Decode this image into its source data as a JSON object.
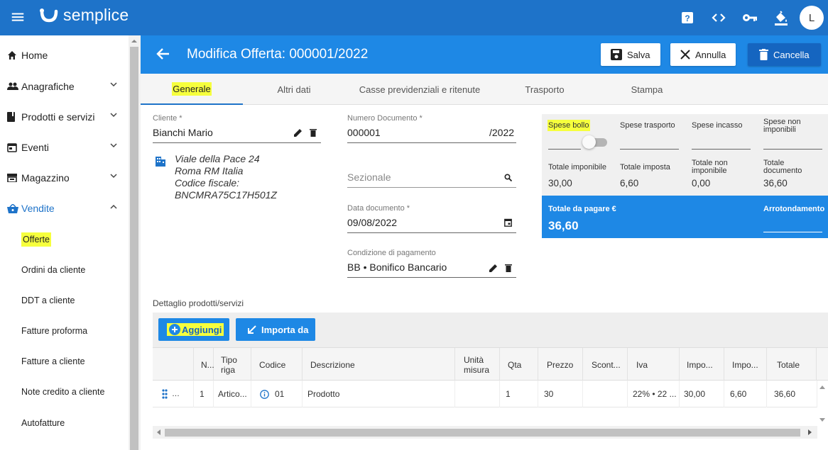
{
  "app": {
    "logo_text": "semplice",
    "avatar_letter": "L"
  },
  "topbar_icons": [
    "help-icon",
    "code-icon",
    "key-icon",
    "paint-bucket-icon"
  ],
  "sidebar": {
    "items": [
      {
        "label": "Home"
      },
      {
        "label": "Anagrafiche"
      },
      {
        "label": "Prodotti e servizi"
      },
      {
        "label": "Eventi"
      },
      {
        "label": "Magazzino"
      },
      {
        "label": "Vendite"
      }
    ],
    "subitems": [
      {
        "label": "Offerte"
      },
      {
        "label": "Ordini da cliente"
      },
      {
        "label": "DDT a cliente"
      },
      {
        "label": "Fatture proforma"
      },
      {
        "label": "Fatture a cliente"
      },
      {
        "label": "Note credito a cliente"
      },
      {
        "label": "Autofatture"
      }
    ]
  },
  "header": {
    "title": "Modifica Offerta: 000001/2022",
    "save_label": "Salva",
    "cancel_label": "Annulla",
    "delete_label": "Cancella"
  },
  "tabs": [
    {
      "label": "Generale"
    },
    {
      "label": "Altri dati"
    },
    {
      "label": "Casse previdenziali e ritenute"
    },
    {
      "label": "Trasporto"
    },
    {
      "label": "Stampa"
    }
  ],
  "form": {
    "cliente_label": "Cliente *",
    "cliente_value": "Bianchi Mario",
    "address": [
      "Viale della Pace 24",
      "Roma RM Italia",
      "Codice fiscale:",
      "BNCMRA75C17H501Z"
    ],
    "numero_label": "Numero Documento *",
    "numero_value": "000001",
    "numero_suffix": "/2022",
    "sezionale_placeholder": "Sezionale",
    "data_label": "Data documento *",
    "data_value": "09/08/2022",
    "condizione_label": "Condizione di pagamento",
    "condizione_value": "BB • Bonifico Bancario"
  },
  "totals": {
    "spese_bollo": "Spese bollo",
    "spese_trasporto": "Spese trasporto",
    "spese_incasso": "Spese incasso",
    "spese_non_imponibili": "Spese non imponibili",
    "totale_imponibile_label": "Totale imponibile",
    "totale_imponibile": "30,00",
    "totale_imposta_label": "Totale imposta",
    "totale_imposta": "6,60",
    "totale_non_imponibile_label": "Totale non imponibile",
    "totale_non_imponibile": "0,00",
    "totale_documento_label": "Totale documento",
    "totale_documento": "36,60",
    "totale_pagare_label": "Totale da pagare €",
    "totale_pagare": "36,60",
    "arrotondamento_label": "Arrotondamento",
    "bollo_toggle_on": false
  },
  "detail": {
    "section_label": "Dettaglio prodotti/servizi",
    "add_label": "Aggiungi",
    "import_label": "Importa da",
    "columns": [
      "N...",
      "Tipo riga",
      "Codice",
      "Descrizione",
      "Unità misura",
      "Qta",
      "Prezzo",
      "Scont...",
      "Iva",
      "Impo...",
      "Impo...",
      "Totale"
    ],
    "rows": [
      {
        "n": "1",
        "tipo": "Artico...",
        "codice": "01",
        "descrizione": "Prodotto",
        "um": "",
        "qta": "1",
        "prezzo": "30",
        "sconto": "",
        "iva": "22% • 22 ...",
        "imponibile": "30,00",
        "imposta": "6,60",
        "totale": "36,60"
      }
    ]
  },
  "colors": {
    "topbar": "#1e73c9",
    "header": "#1e88e5",
    "accent": "#1565c0",
    "highlight": "#f6ff3d"
  }
}
